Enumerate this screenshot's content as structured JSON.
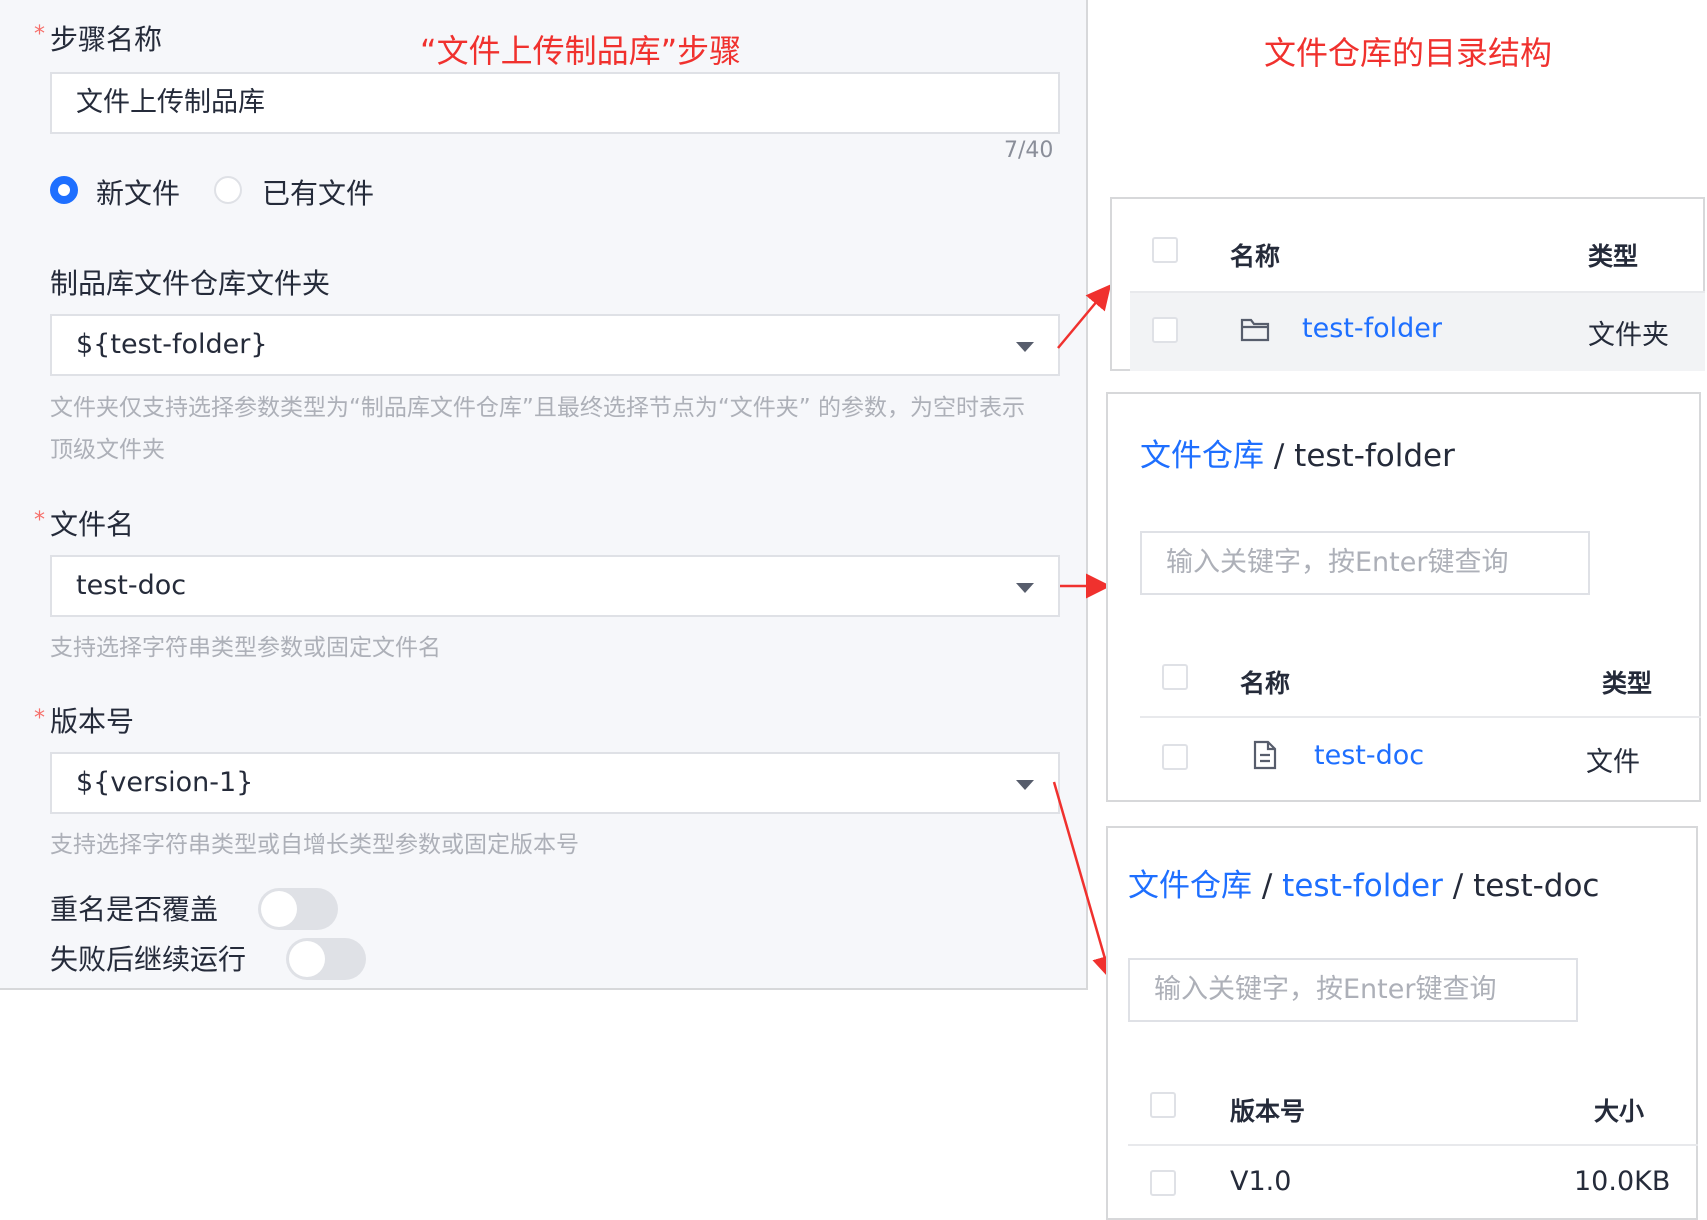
{
  "form": {
    "step_name_label": "步骤名称",
    "step_name_value": "文件上传制品库",
    "step_name_count": "7/40",
    "radio_new": "新文件",
    "radio_existing": "已有文件",
    "folder_label": "制品库文件仓库文件夹",
    "folder_value": "${test-folder}",
    "folder_hint_line1": "文件夹仅支持选择参数类型为“制品库文件仓库”且最终选择节点为“文件夹” 的参数，为空时表示",
    "folder_hint_line2": "顶级文件夹",
    "filename_label": "文件名",
    "filename_value": "test-doc",
    "filename_hint": "支持选择字符串类型参数或固定文件名",
    "version_label": "版本号",
    "version_value": "${version-1}",
    "version_hint": "支持选择字符串类型或自增长类型参数或固定版本号",
    "overwrite_label": "重名是否覆盖",
    "continue_label": "失败后继续运行",
    "required_mark": "*"
  },
  "annotations": {
    "step_title": "“文件上传制品库”步骤",
    "repo_title": "文件仓库的目录结构"
  },
  "panel1": {
    "col_name": "名称",
    "col_type": "类型",
    "row_name": "test-folder",
    "row_type": "文件夹"
  },
  "panel2": {
    "crumb_root": "文件仓库",
    "crumb_sep": "/",
    "crumb_current": "test-folder",
    "search_placeholder": "输入关键字，按Enter键查询",
    "col_name": "名称",
    "col_type": "类型",
    "row_name": "test-doc",
    "row_type": "文件"
  },
  "panel3": {
    "crumb_root": "文件仓库",
    "crumb_sep": "/",
    "crumb_mid": "test-folder",
    "crumb_current": "test-doc",
    "search_placeholder": "输入关键字，按Enter键查询",
    "col_version": "版本号",
    "col_size": "大小",
    "row_version": "V1.0",
    "row_size": "10.0KB"
  },
  "colors": {
    "accent": "#1e6fff",
    "annotation": "#f0312e",
    "required": "#f66f6a"
  }
}
